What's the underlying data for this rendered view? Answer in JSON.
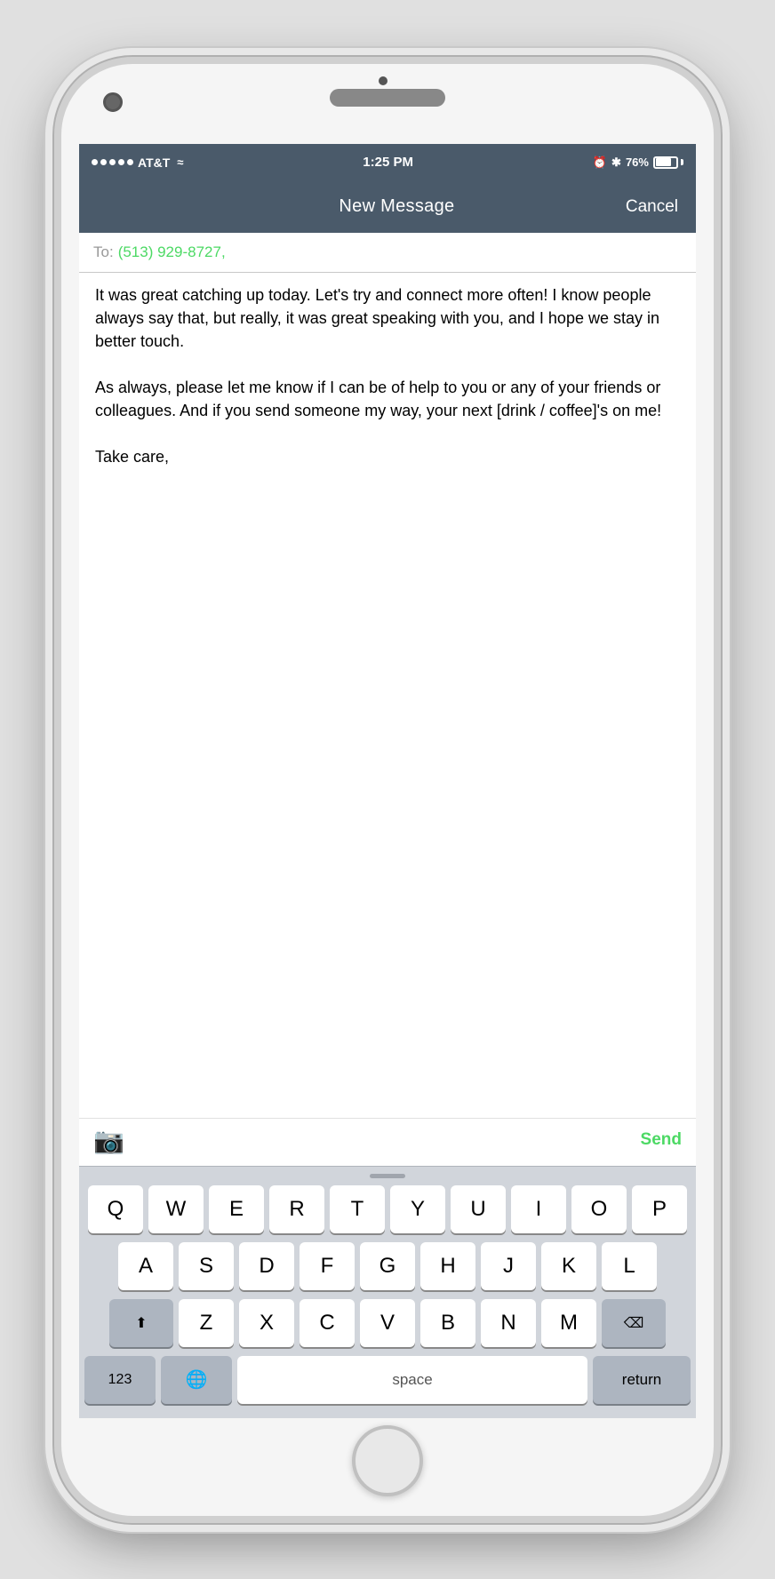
{
  "phone": {
    "status_bar": {
      "carrier": "AT&T",
      "time": "1:25 PM",
      "battery_pct": "76%",
      "signal_dots": 5
    },
    "nav": {
      "title": "New Message",
      "cancel_label": "Cancel"
    },
    "to_field": {
      "label": "To:",
      "contact": "(513) 929-8727,"
    },
    "message": {
      "body": "It was great catching up today. Let's try and connect more often! I know people always say that, but really, it was great speaking with you, and I hope we stay in better touch.\n\nAs always, please let me know if I can be of help to you or any of your friends or colleagues. And if you send someone my way, your next [drink / coffee]'s on me!\n\nTake care,"
    },
    "action_bar": {
      "send_label": "Send"
    },
    "keyboard": {
      "row1": [
        "Q",
        "W",
        "E",
        "R",
        "T",
        "Y",
        "U",
        "I",
        "O",
        "P"
      ],
      "row2": [
        "A",
        "S",
        "D",
        "F",
        "G",
        "H",
        "J",
        "K",
        "L"
      ],
      "row3": [
        "Z",
        "X",
        "C",
        "V",
        "B",
        "N",
        "M"
      ],
      "bottom": {
        "numbers_label": "123",
        "globe_label": "🌐",
        "space_label": "space",
        "return_label": "return",
        "delete_label": "⌫",
        "shift_label": "⬆"
      }
    }
  }
}
